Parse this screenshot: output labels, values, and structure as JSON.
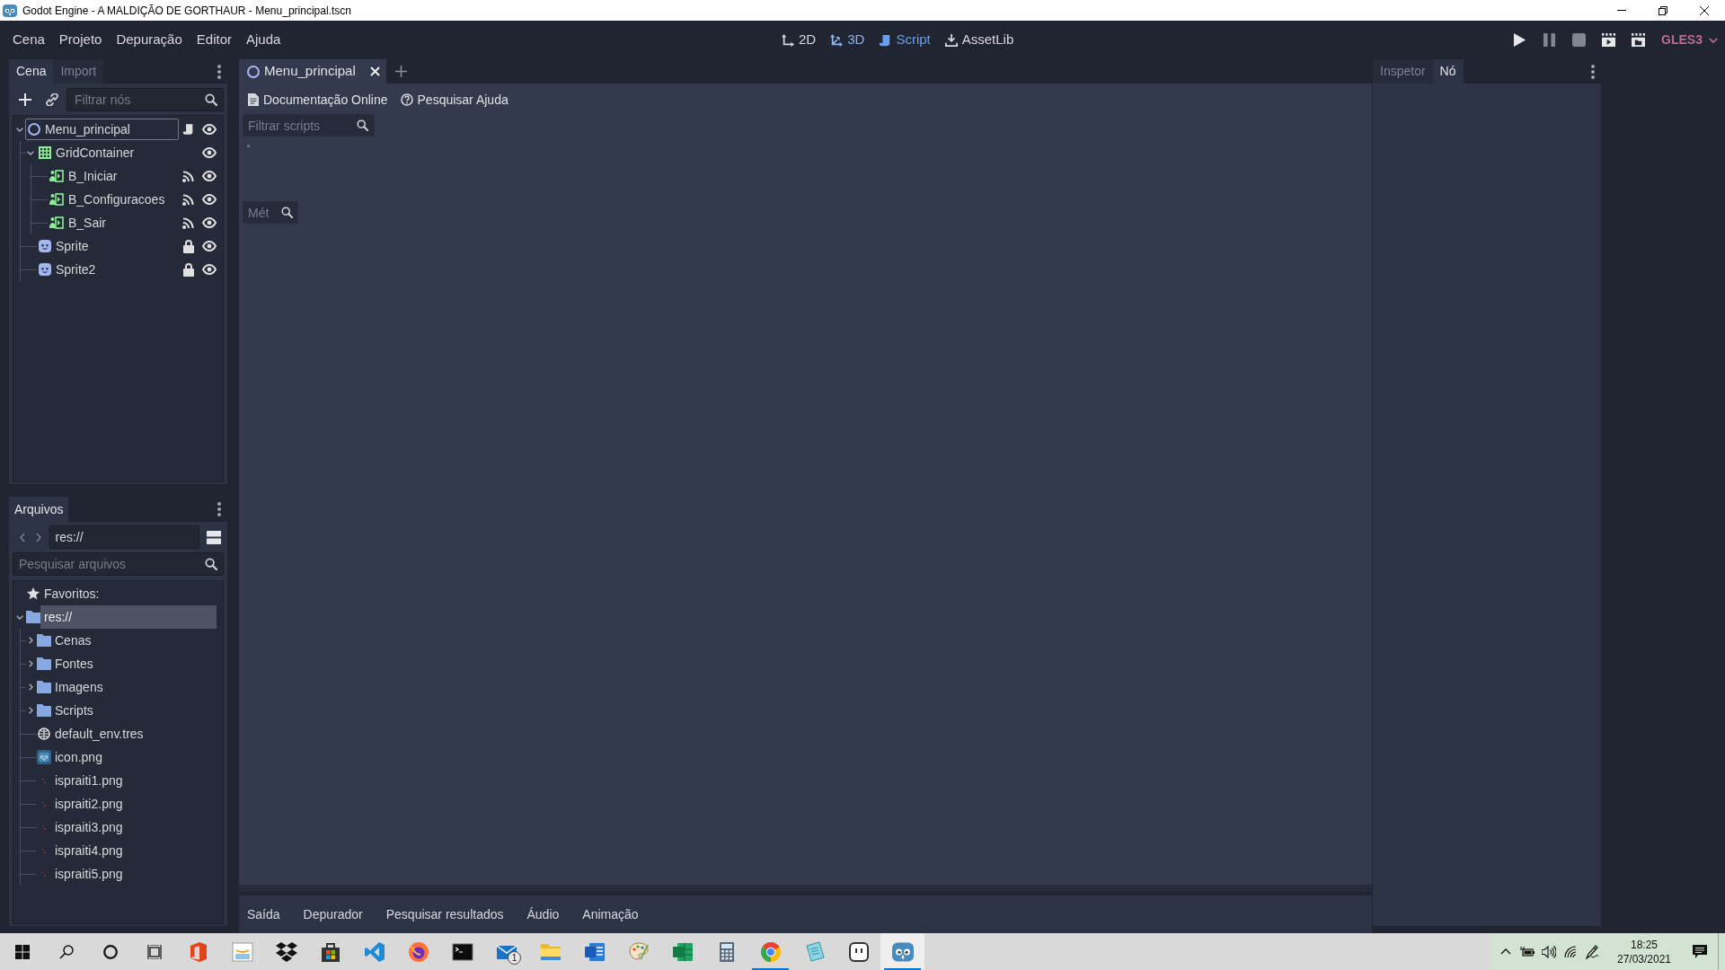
{
  "window": {
    "title": "Godot Engine - A MALDIÇÃO DE GORTHAUR - Menu_principal.tscn"
  },
  "menu": [
    "Cena",
    "Projeto",
    "Depuração",
    "Editor",
    "Ajuda"
  ],
  "workspaces": [
    {
      "label": "2D",
      "kind": "canvas",
      "selected": false,
      "hovered": false
    },
    {
      "label": "3D",
      "kind": "spatial",
      "selected": false,
      "hovered": true
    },
    {
      "label": "Script",
      "kind": "script",
      "selected": true,
      "hovered": false
    },
    {
      "label": "AssetLib",
      "kind": "assetlib",
      "selected": false,
      "hovered": false
    }
  ],
  "run_buttons": [
    {
      "kind": "play",
      "disabled": false
    },
    {
      "kind": "pause",
      "disabled": true
    },
    {
      "kind": "stop",
      "disabled": true
    },
    {
      "kind": "play_scene",
      "disabled": false
    },
    {
      "kind": "play_custom",
      "disabled": false
    }
  ],
  "renderer": "GLES3",
  "scene_dock": {
    "tabs": [
      {
        "label": "Cena",
        "selected": true
      },
      {
        "label": "Import",
        "selected": false
      }
    ],
    "filter": {
      "placeholder": "Filtrar nós"
    },
    "tree": [
      {
        "name": "Menu_principal",
        "kind": "node",
        "selected": true,
        "expanded": true,
        "has_script": true,
        "has_signals": false,
        "locked": false,
        "visible": true,
        "children": [
          {
            "name": "GridContainer",
            "kind": "grid",
            "selected": false,
            "expanded": true,
            "has_script": false,
            "has_signals": false,
            "locked": false,
            "visible": true,
            "children": [
              {
                "name": "B_Iniciar",
                "kind": "button",
                "selected": false,
                "has_script": false,
                "has_signals": true,
                "locked": false,
                "visible": true
              },
              {
                "name": "B_Configuracoes",
                "kind": "button",
                "selected": false,
                "has_script": false,
                "has_signals": true,
                "locked": false,
                "visible": true
              },
              {
                "name": "B_Sair",
                "kind": "button",
                "selected": false,
                "has_script": false,
                "has_signals": true,
                "locked": false,
                "visible": true
              }
            ]
          },
          {
            "name": "Sprite",
            "kind": "sprite",
            "selected": false,
            "has_script": false,
            "has_signals": false,
            "locked": true,
            "visible": true
          },
          {
            "name": "Sprite2",
            "kind": "sprite",
            "selected": false,
            "has_script": false,
            "has_signals": false,
            "locked": true,
            "visible": true
          }
        ]
      }
    ]
  },
  "files_dock": {
    "tab": "Arquivos",
    "path": "res://",
    "search": {
      "placeholder": "Pesquisar arquivos"
    },
    "tree": [
      {
        "name": "Favoritos:",
        "kind": "favorites",
        "selected": false
      },
      {
        "name": "res://",
        "kind": "folder",
        "selected": true,
        "expanded": true,
        "children": [
          {
            "name": "Cenas",
            "kind": "folder",
            "selected": false,
            "expanded": false
          },
          {
            "name": "Fontes",
            "kind": "folder",
            "selected": false,
            "expanded": false
          },
          {
            "name": "Imagens",
            "kind": "folder",
            "selected": false,
            "expanded": false
          },
          {
            "name": "Scripts",
            "kind": "folder",
            "selected": false,
            "expanded": false
          },
          {
            "name": "default_env.tres",
            "kind": "environment",
            "selected": false
          },
          {
            "name": "icon.png",
            "kind": "app_icon",
            "selected": false
          },
          {
            "name": "ispraiti1.png",
            "kind": "image",
            "selected": false
          },
          {
            "name": "ispraiti2.png",
            "kind": "image",
            "selected": false
          },
          {
            "name": "ispraiti3.png",
            "kind": "image",
            "selected": false
          },
          {
            "name": "ispraiti4.png",
            "kind": "image",
            "selected": false
          },
          {
            "name": "ispraiti5.png",
            "kind": "image",
            "selected": false
          }
        ]
      }
    ]
  },
  "editor_tabs": [
    {
      "label": "Menu_principal",
      "selected": true
    }
  ],
  "script_panel": {
    "help_buttons": [
      "Documentação Online",
      "Pesquisar Ajuda"
    ],
    "filter": {
      "placeholder": "Filtrar scripts"
    },
    "methods_filter": {
      "placeholder": "Mét"
    }
  },
  "bottom_tabs": [
    {
      "label": "Saída",
      "selected": false
    },
    {
      "label": "Depurador",
      "selected": false
    },
    {
      "label": "Pesquisar resultados",
      "selected": false
    },
    {
      "label": "Áudio",
      "selected": false
    },
    {
      "label": "Animação",
      "selected": false
    }
  ],
  "right_dock": {
    "tabs": [
      {
        "label": "Inspetor",
        "selected": false
      },
      {
        "label": "Nó",
        "selected": true
      }
    ]
  },
  "taskbar": {
    "apps": [
      {
        "running": false,
        "active": false
      },
      {
        "running": false,
        "active": false
      },
      {
        "running": false,
        "active": false
      },
      {
        "running": false,
        "active": false
      },
      {
        "running": false,
        "active": false
      },
      {
        "running": false,
        "active": false
      },
      {
        "running": false,
        "active": false
      },
      {
        "running": false,
        "active": false,
        "badge": "1"
      },
      {
        "running": false,
        "active": false
      },
      {
        "running": false,
        "active": false
      },
      {
        "running": false,
        "active": false
      },
      {
        "running": false,
        "active": false
      },
      {
        "running": false,
        "active": false
      },
      {
        "running": true,
        "active": false
      },
      {
        "running": false,
        "active": false
      },
      {
        "running": false,
        "active": false
      },
      {
        "running": true,
        "active": true
      }
    ],
    "clock": {
      "time": "18:25",
      "date": "27/03/2021"
    }
  }
}
